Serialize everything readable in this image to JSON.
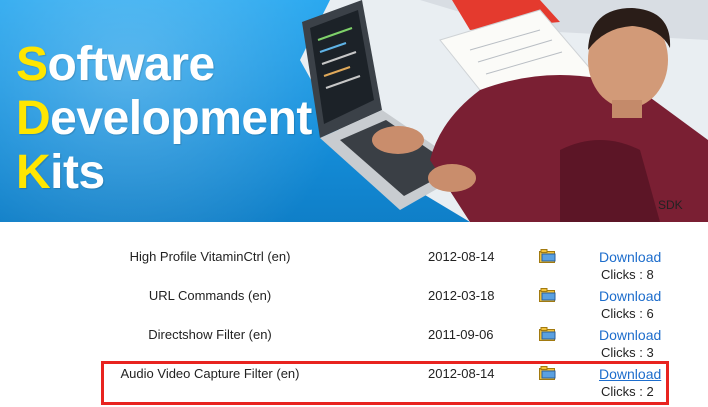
{
  "banner": {
    "title_lines": [
      {
        "cap": "S",
        "rest": "oftware"
      },
      {
        "cap": "D",
        "rest": "evelopment"
      },
      {
        "cap": "K",
        "rest": "its"
      }
    ],
    "corner_label": "SDK"
  },
  "downloads": [
    {
      "name": "High Profile VitaminCtrl (en)",
      "date": "2012-08-14",
      "icon": "folder-icon",
      "link": "Download",
      "clicks": "Clicks : 8"
    },
    {
      "name": "URL Commands (en)",
      "date": "2012-03-18",
      "icon": "folder-icon",
      "link": "Download",
      "clicks": "Clicks : 6"
    },
    {
      "name": "Directshow Filter (en)",
      "date": "2011-09-06",
      "icon": "folder-icon",
      "link": "Download",
      "clicks": "Clicks : 3"
    },
    {
      "name": "Audio Video Capture Filter (en)",
      "date": "2012-08-14",
      "icon": "folder-icon",
      "link": "Download",
      "clicks": "Clicks : 2"
    }
  ],
  "colors": {
    "accent": "#1d6dcc",
    "highlight": "#e8231f",
    "title_cap": "#ffe600",
    "banner": "#1690dc"
  }
}
